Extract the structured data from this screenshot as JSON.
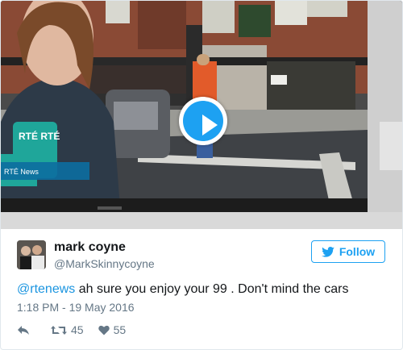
{
  "tweet": {
    "author_name": "mark coyne",
    "author_handle": "@MarkSkinnycoyne",
    "follow_label": "Follow",
    "text_mention": "@rtenews",
    "text_body": " ah sure you enjoy your 99 . Don't mind the cars",
    "timestamp": "1:18 PM - 19 May 2016",
    "retweet_count": "45",
    "like_count": "55"
  },
  "media": {
    "microphone_logo": "RTÉ RTÉ",
    "lower_third_text": "RTÉ News"
  },
  "icons": {
    "play": "play-icon",
    "twitter_bird": "twitter-bird-icon",
    "reply": "reply-icon",
    "retweet": "retweet-icon",
    "like": "heart-icon"
  },
  "colors": {
    "accent": "#1da1f2",
    "link": "#1b95e0",
    "secondary_text": "#657786",
    "primary_text": "#14171a",
    "border": "#e1e8ed"
  }
}
